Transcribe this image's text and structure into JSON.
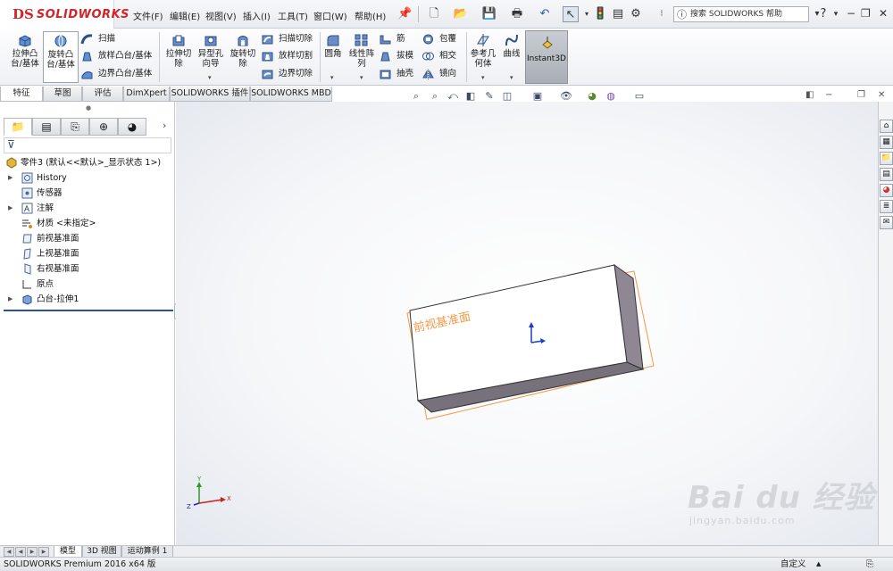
{
  "app": {
    "logo_prefix": "DS",
    "logo_name": "SOLIDWORKS",
    "brand_color": "#d0262b"
  },
  "menu": [
    "文件(F)",
    "编辑(E)",
    "视图(V)",
    "插入(I)",
    "工具(T)",
    "窗口(W)",
    "帮助(H)"
  ],
  "search": {
    "placeholder": "搜索 SOLIDWORKS 帮助"
  },
  "commands": {
    "extrude_boss": "拉伸凸台/基体",
    "revolve_boss": "旋转凸台/基体",
    "sweep": "扫描",
    "loft_boss": "放样凸台/基体",
    "boundary_boss": "边界凸台/基体",
    "extrude_cut": "拉伸切除",
    "hole_wizard": "异型孔向导",
    "revolve_cut": "旋转切除",
    "swept_cut": "扫描切除",
    "lofted_cut": "放样切割",
    "boundary_cut": "边界切除",
    "fillet": "圆角",
    "linear_pattern": "线性阵列",
    "rib": "筋",
    "draft": "拔模",
    "shell": "抽壳",
    "wrap": "包覆",
    "intersect": "相交",
    "mirror": "镜向",
    "ref_geometry": "参考几何体",
    "curves": "曲线",
    "instant3d": "Instant3D"
  },
  "tabs": [
    "特征",
    "草图",
    "评估",
    "DimXpert",
    "SOLIDWORKS 插件",
    "SOLIDWORKS MBD"
  ],
  "active_tab": "特征",
  "tree": {
    "root": "零件3 (默认<<默认>_显示状态 1>)",
    "items": [
      {
        "label": "History",
        "icon": "history-icon",
        "expandable": true
      },
      {
        "label": "传感器",
        "icon": "sensor-icon",
        "expandable": false
      },
      {
        "label": "注解",
        "icon": "annotations-icon",
        "expandable": true
      },
      {
        "label": "材质 <未指定>",
        "icon": "material-icon",
        "expandable": false
      },
      {
        "label": "前视基准面",
        "icon": "plane-icon",
        "expandable": false
      },
      {
        "label": "上视基准面",
        "icon": "plane-icon",
        "expandable": false
      },
      {
        "label": "右视基准面",
        "icon": "plane-icon",
        "expandable": false
      },
      {
        "label": "原点",
        "icon": "origin-icon",
        "expandable": false
      },
      {
        "label": "凸台-拉伸1",
        "icon": "extrude-feature-icon",
        "expandable": true
      }
    ]
  },
  "viewport": {
    "plane_label": "前视基准面",
    "triad": {
      "x": "X",
      "y": "Y",
      "z": "Z"
    },
    "plane_color": "#f39a4a",
    "face_color": "#ffffff",
    "side_color": "#8f8794",
    "bottom_color": "#77717c"
  },
  "bottom_tabs": [
    "模型",
    "3D 视图",
    "运动算例 1"
  ],
  "active_bottom_tab": "模型",
  "status": {
    "product": "SOLIDWORKS Premium 2016 x64 版",
    "customize": "自定义"
  },
  "watermark": {
    "brand": "Bai du 经验",
    "url": "jingyan.baidu.com"
  }
}
